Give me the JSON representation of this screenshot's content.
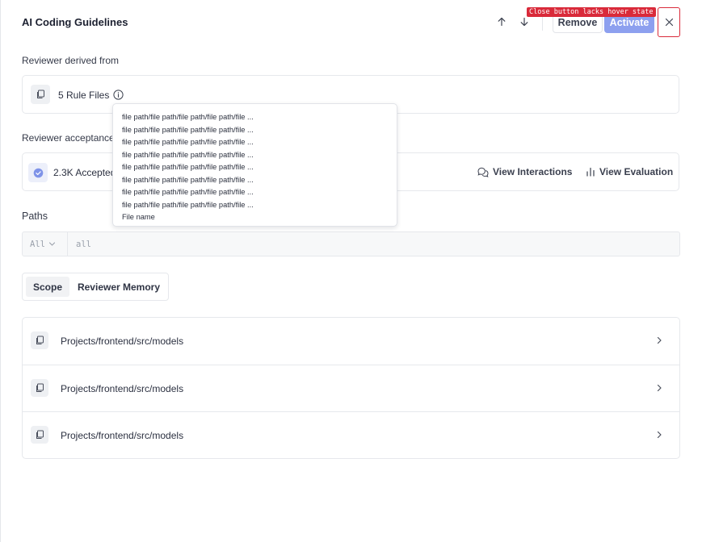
{
  "header": {
    "title": "AI Coding Guidelines",
    "remove_label": "Remove",
    "activate_label": "Activate",
    "annotation": "Close button lacks hover state"
  },
  "derived": {
    "label": "Reviewer derived from",
    "rule_files": "5 Rule Files"
  },
  "acceptance": {
    "label": "Reviewer acceptance",
    "accepted": "2.3K Accepted",
    "view_interactions": "View Interactions",
    "view_evaluation": "View Evaluation"
  },
  "paths": {
    "label": "Paths",
    "select_value": "All",
    "input_placeholder": "all"
  },
  "tabs": [
    {
      "label": "Scope"
    },
    {
      "label": "Reviewer Memory"
    }
  ],
  "list": [
    {
      "label": "Projects/frontend/src/models"
    },
    {
      "label": "Projects/frontend/src/models"
    },
    {
      "label": "Projects/frontend/src/models"
    }
  ],
  "popover": {
    "lines": [
      "file path/file path/file path/file path/file ...",
      "file path/file path/file path/file path/file ...",
      "file path/file path/file path/file path/file ...",
      "file path/file path/file path/file path/file ...",
      "file path/file path/file path/file path/file ...",
      "file path/file path/file path/file path/file ...",
      "file path/file path/file path/file path/file ...",
      "file path/file path/file path/file path/file ...",
      "File name"
    ]
  },
  "colors": {
    "accent": "#8da0ef",
    "annotation": "#d92a3a",
    "border": "#e6e8ec"
  }
}
